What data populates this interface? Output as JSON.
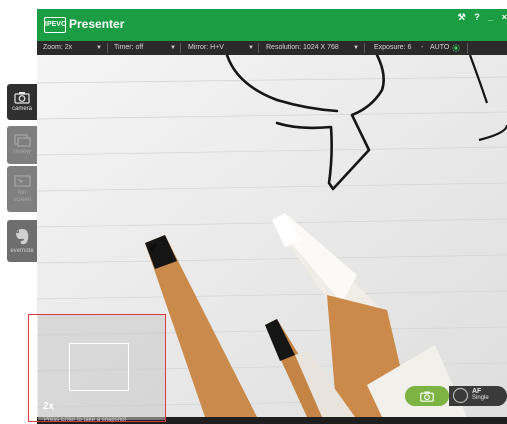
{
  "app": {
    "logo_text": "IPEVO",
    "title": "Presenter",
    "controls": {
      "settings": "⚒",
      "help": "?",
      "minimize": "_",
      "close": "×"
    }
  },
  "toolbar": {
    "zoom": "Zoom: 2x",
    "timer": "Timer: off",
    "mirror": "Mirror: H+V",
    "resolution": "Resolution: 1024 X 768",
    "exposure": "Exposure: 6",
    "exposure_sep": "-",
    "exposure_auto": "AUTO"
  },
  "sidebar": {
    "items": [
      {
        "label": "camera",
        "state": "active",
        "icon": "camera-icon"
      },
      {
        "label": "review",
        "state": "disabled",
        "icon": "review-icon"
      },
      {
        "label": "full screen",
        "state": "disabled",
        "icon": "fullscreen-icon"
      },
      {
        "label": "evernote",
        "state": "normal",
        "icon": "evernote-icon"
      }
    ]
  },
  "preview": {
    "zoom_level": "2x"
  },
  "capture": {
    "af_line1": "AF",
    "af_line2": "Single"
  },
  "status": {
    "text": "Press Enter to take a snapshot"
  },
  "colors": {
    "brand_green": "#1a9d43",
    "capture_green": "#7cb342",
    "highlight_red": "#e0383d"
  }
}
